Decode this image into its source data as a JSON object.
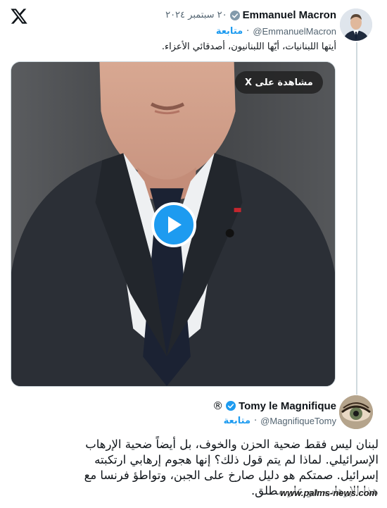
{
  "app": {
    "logo_icon": "x-logo-icon"
  },
  "tweet": {
    "author_name": "Emmanuel Macron",
    "verified_icon": "verified-badge-icon",
    "date": "٢٠ سبتمبر ٢٠٢٤",
    "handle": "@EmmanuelMacron",
    "follow_label": "متابعة",
    "text": "أيتها اللبنانيات، أيّها اللبنانيون، أصدقائي الأعزاء.",
    "media": {
      "watch_label": "مشاهدة على X",
      "play_icon": "play-icon"
    }
  },
  "reply": {
    "author_name": "Tomy le Magnifique",
    "registered_mark": "®",
    "handle": "@MagnifiqueTomy",
    "follow_label": "متابعة",
    "text_lines": [
      "لبنان ليس فقط ضحية الحزن والخوف، بل أيضاً ضحية الإرهاب",
      "الإسرائيلي. لماذا لم يتم قول ذلك؟ إنها هجوم إرهابي ارتكبته",
      "إسرائيل. صمتكم هو دليل صارخ على الجبن، وتواطؤ فرنسا مع",
      "هذا الإرهاب هو عار مطلق."
    ]
  },
  "watermark": "www.palms-news.com",
  "colors": {
    "accent": "#1d9bf0",
    "secondary_text": "#536471",
    "text": "#0f1419",
    "thread_line": "#cfd9de"
  }
}
